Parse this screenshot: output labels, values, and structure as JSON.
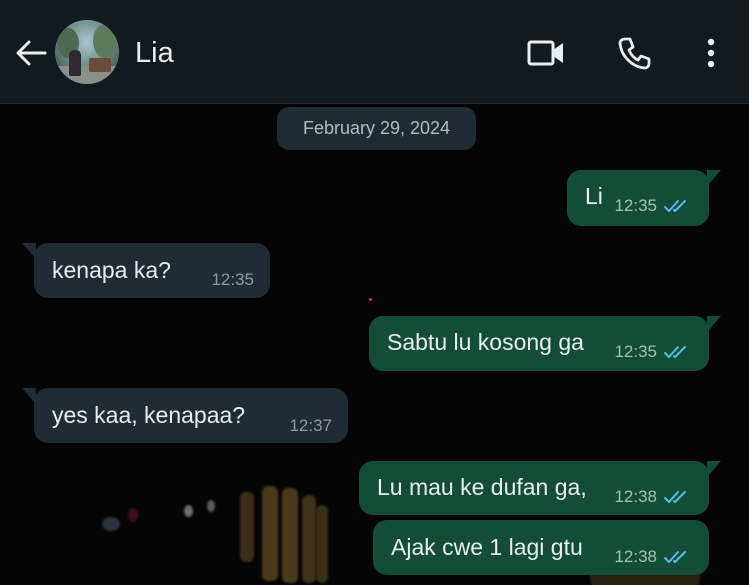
{
  "contact": {
    "name": "Lia"
  },
  "date_chip": "February 29, 2024",
  "messages": [
    {
      "direction": "outgoing",
      "text": "Li",
      "time": "12:35",
      "status": "read"
    },
    {
      "direction": "incoming",
      "text": "kenapa ka?",
      "time": "12:35"
    },
    {
      "direction": "outgoing",
      "text": "Sabtu lu kosong ga",
      "time": "12:35",
      "status": "read"
    },
    {
      "direction": "incoming",
      "text": "yes kaa, kenapaa?",
      "time": "12:37"
    },
    {
      "direction": "outgoing",
      "text": "Lu mau ke dufan ga,",
      "time": "12:38",
      "status": "read"
    },
    {
      "direction": "outgoing",
      "text": "Ajak cwe 1 lagi gtu",
      "time": "12:38",
      "status": "read"
    }
  ],
  "header_icons": [
    "back-arrow-icon",
    "video-call-icon",
    "phone-call-icon",
    "more-options-icon"
  ],
  "colors": {
    "header_bg": "#111a20",
    "outgoing_bubble": "#134d37",
    "incoming_bubble": "#1f2c33",
    "read_tick": "#53bdeb",
    "text": "#e9edef"
  }
}
